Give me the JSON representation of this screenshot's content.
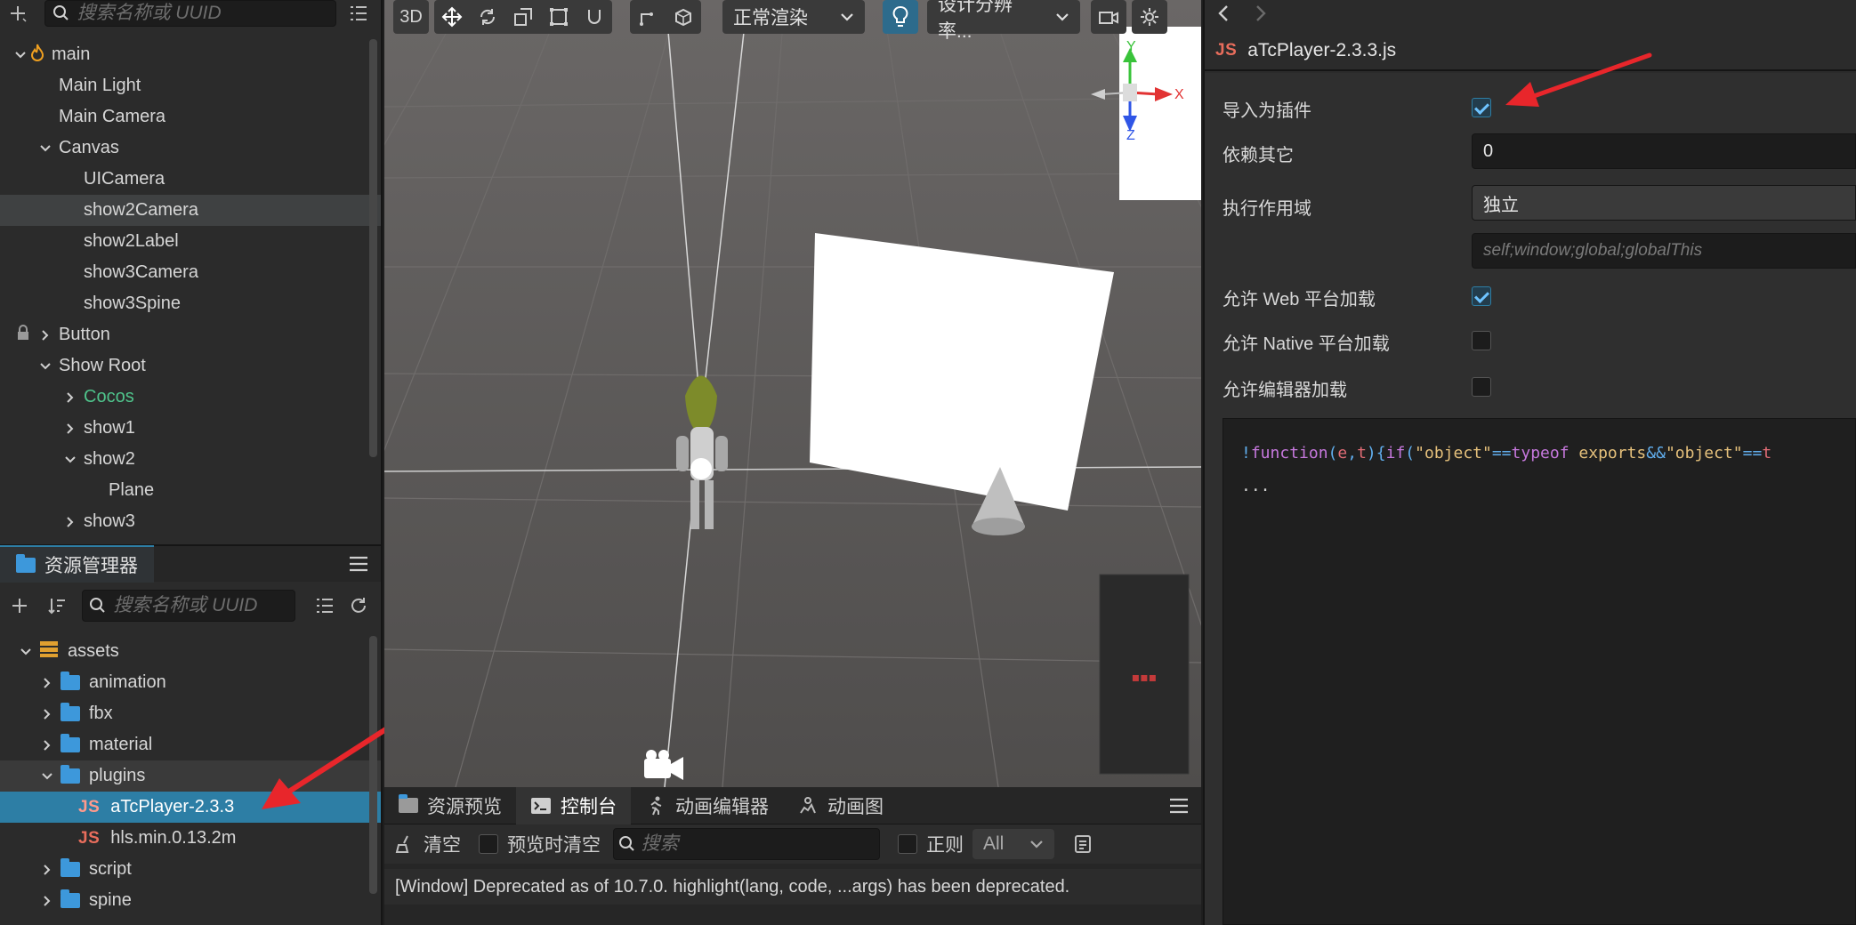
{
  "hierarchy": {
    "search_placeholder": "搜索名称或 UUID",
    "nodes": [
      {
        "label": "main",
        "depth": 0,
        "expanded": true,
        "icon": "fire-icon"
      },
      {
        "label": "Main Light",
        "depth": 1
      },
      {
        "label": "Main Camera",
        "depth": 1
      },
      {
        "label": "Canvas",
        "depth": 1,
        "expanded": true
      },
      {
        "label": "UICamera",
        "depth": 2
      },
      {
        "label": "show2Camera",
        "depth": 2,
        "selected": true
      },
      {
        "label": "show2Label",
        "depth": 2
      },
      {
        "label": "show3Camera",
        "depth": 2
      },
      {
        "label": "show3Spine",
        "depth": 2
      },
      {
        "label": "Button",
        "depth": 1,
        "collapsed": true,
        "locked": true
      },
      {
        "label": "Show Root",
        "depth": 1,
        "expanded": true
      },
      {
        "label": "Cocos",
        "depth": 2,
        "collapsed": true,
        "color": "#4fc38b"
      },
      {
        "label": "show1",
        "depth": 2,
        "collapsed": true
      },
      {
        "label": "show2",
        "depth": 2,
        "expanded": true
      },
      {
        "label": "Plane",
        "depth": 3
      },
      {
        "label": "show3",
        "depth": 2,
        "collapsed": true
      }
    ]
  },
  "assets": {
    "tab_label": "资源管理器",
    "search_placeholder": "搜索名称或 UUID",
    "nodes": [
      {
        "label": "assets",
        "depth": 0,
        "expanded": true,
        "icon": "db"
      },
      {
        "label": "animation",
        "depth": 1,
        "icon": "folder",
        "collapsed": true
      },
      {
        "label": "fbx",
        "depth": 1,
        "icon": "folder",
        "collapsed": true
      },
      {
        "label": "material",
        "depth": 1,
        "icon": "folder",
        "collapsed": true
      },
      {
        "label": "plugins",
        "depth": 1,
        "icon": "folder",
        "expanded": true,
        "hover": true
      },
      {
        "label": "aTcPlayer-2.3.3",
        "depth": 2,
        "icon": "js",
        "active": true
      },
      {
        "label": "hls.min.0.13.2m",
        "depth": 2,
        "icon": "js"
      },
      {
        "label": "script",
        "depth": 1,
        "icon": "folder",
        "collapsed": true
      },
      {
        "label": "spine",
        "depth": 1,
        "icon": "folder",
        "collapsed": true
      }
    ]
  },
  "scene": {
    "btn_3d": "3D",
    "render_mode": "正常渲染",
    "resolution": "设计分辨率...",
    "gizmo": {
      "y": "Y",
      "x": "X",
      "z": "Z"
    }
  },
  "console": {
    "tabs": [
      {
        "label": "资源预览",
        "icon": "folder-icon"
      },
      {
        "label": "控制台",
        "icon": "terminal-icon",
        "active": true
      },
      {
        "label": "动画编辑器",
        "icon": "run-icon"
      },
      {
        "label": "动画图",
        "icon": "graph-icon"
      }
    ],
    "clear_label": "清空",
    "preview_clear_label": "预览时清空",
    "search_placeholder": "搜索",
    "regex_label": "正则",
    "level_value": "All",
    "message": "[Window] Deprecated as of 10.7.0. highlight(lang, code, ...args) has been deprecated."
  },
  "inspector": {
    "title": "aTcPlayer-2.3.3.js",
    "file_type": "JS",
    "rows": {
      "import_plugin": {
        "label": "导入为插件",
        "checked": true
      },
      "depends": {
        "label": "依赖其它",
        "value": "0"
      },
      "scope": {
        "label": "执行作用域",
        "value": "独立",
        "placeholder": "self;window;global;globalThis"
      },
      "web": {
        "label": "允许 Web 平台加载",
        "checked": true
      },
      "native": {
        "label": "允许 Native 平台加载",
        "checked": false
      },
      "editor": {
        "label": "允许编辑器加载",
        "checked": false
      }
    },
    "code": {
      "p1": "!",
      "kw1": "function",
      "p2": "(",
      "a1": "e",
      "p3": ",",
      "a2": "t",
      "p4": "){",
      "kw2": "if",
      "p5": "(",
      "s1": "\"object\"",
      "op1": "==",
      "kw3": "typeof",
      "id1": " exports",
      "op2": "&&",
      "s2": "\"object\"",
      "op3": "==",
      "tail": "t",
      "line2": "..."
    }
  },
  "colors": {
    "accent": "#2d7ea5",
    "arrow_red": "#e8262b",
    "js_red": "#e86d5c",
    "green": "#4fc38b"
  }
}
